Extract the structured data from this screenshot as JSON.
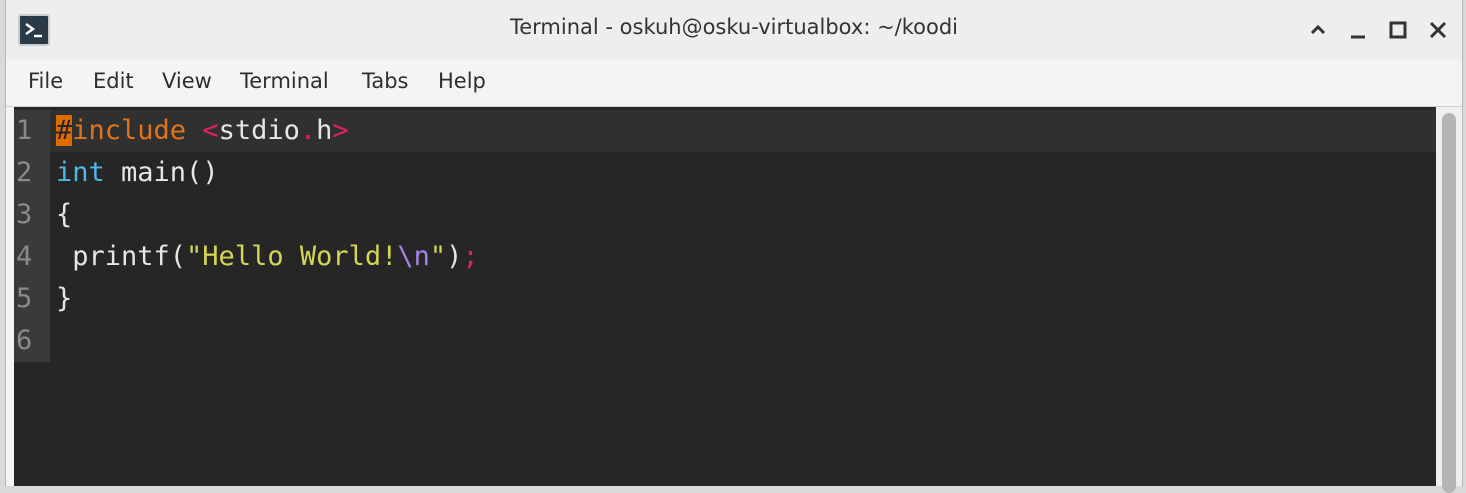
{
  "window": {
    "title": "Terminal - oskuh@osku-virtualbox: ~/koodi"
  },
  "icons": {
    "app": "terminal-icon",
    "maximize": "chevron-up-icon",
    "minimize": "minimize-icon",
    "restore": "maximize-icon",
    "close": "close-icon"
  },
  "menu": {
    "file": "File",
    "edit": "Edit",
    "view": "View",
    "terminal": "Terminal",
    "tabs": "Tabs",
    "help": "Help"
  },
  "editor": {
    "lines": [
      {
        "number": "1",
        "parts": {
          "cursor": "#",
          "directive": "include",
          "space": " ",
          "lt": "<",
          "header_name": "stdio",
          "dot": ".",
          "header_ext": "h",
          "gt": ">"
        }
      },
      {
        "number": "2",
        "parts": {
          "type": "int",
          "rest": " main()"
        }
      },
      {
        "number": "3",
        "parts": {
          "text": "{"
        }
      },
      {
        "number": "4",
        "parts": {
          "pre": " printf(",
          "str_open": "\"Hello World!",
          "escape": "\\n",
          "str_close": "\"",
          "paren": ")",
          "semi": ";"
        }
      },
      {
        "number": "5",
        "parts": {
          "text": "}"
        }
      },
      {
        "number": "6",
        "parts": {
          "text": ""
        }
      }
    ]
  },
  "colors": {
    "background": "#262626",
    "preprocessor": "#e0741a",
    "operator": "#e02060",
    "keyword": "#4fb6e8",
    "string": "#d4d455",
    "escape": "#a582e6"
  }
}
